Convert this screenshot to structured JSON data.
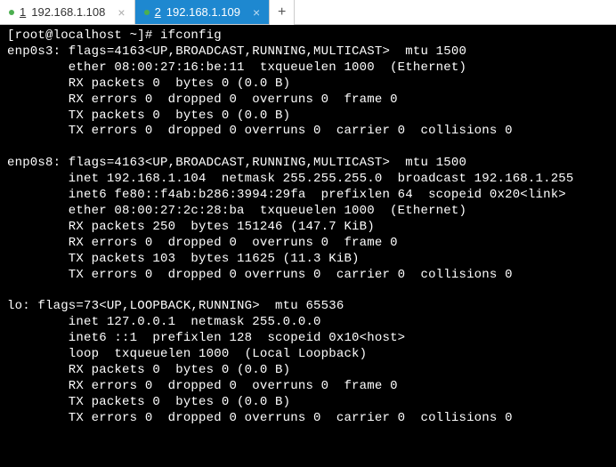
{
  "tabs": [
    {
      "index": "1",
      "label": "192.168.1.108",
      "active": false
    },
    {
      "index": "2",
      "label": "192.168.1.109",
      "active": true
    }
  ],
  "new_tab_label": "+",
  "close_glyph": "×",
  "terminal": {
    "prompt": "[root@localhost ~]# ",
    "command": "ifconfig",
    "output_lines": [
      "enp0s3: flags=4163<UP,BROADCAST,RUNNING,MULTICAST>  mtu 1500",
      "        ether 08:00:27:16:be:11  txqueuelen 1000  (Ethernet)",
      "        RX packets 0  bytes 0 (0.0 B)",
      "        RX errors 0  dropped 0  overruns 0  frame 0",
      "        TX packets 0  bytes 0 (0.0 B)",
      "        TX errors 0  dropped 0 overruns 0  carrier 0  collisions 0",
      "",
      "enp0s8: flags=4163<UP,BROADCAST,RUNNING,MULTICAST>  mtu 1500",
      "        inet 192.168.1.104  netmask 255.255.255.0  broadcast 192.168.1.255",
      "        inet6 fe80::f4ab:b286:3994:29fa  prefixlen 64  scopeid 0x20<link>",
      "        ether 08:00:27:2c:28:ba  txqueuelen 1000  (Ethernet)",
      "        RX packets 250  bytes 151246 (147.7 KiB)",
      "        RX errors 0  dropped 0  overruns 0  frame 0",
      "        TX packets 103  bytes 11625 (11.3 KiB)",
      "        TX errors 0  dropped 0 overruns 0  carrier 0  collisions 0",
      "",
      "lo: flags=73<UP,LOOPBACK,RUNNING>  mtu 65536",
      "        inet 127.0.0.1  netmask 255.0.0.0",
      "        inet6 ::1  prefixlen 128  scopeid 0x10<host>",
      "        loop  txqueuelen 1000  (Local Loopback)",
      "        RX packets 0  bytes 0 (0.0 B)",
      "        RX errors 0  dropped 0  overruns 0  frame 0",
      "        TX packets 0  bytes 0 (0.0 B)",
      "        TX errors 0  dropped 0 overruns 0  carrier 0  collisions 0"
    ]
  }
}
